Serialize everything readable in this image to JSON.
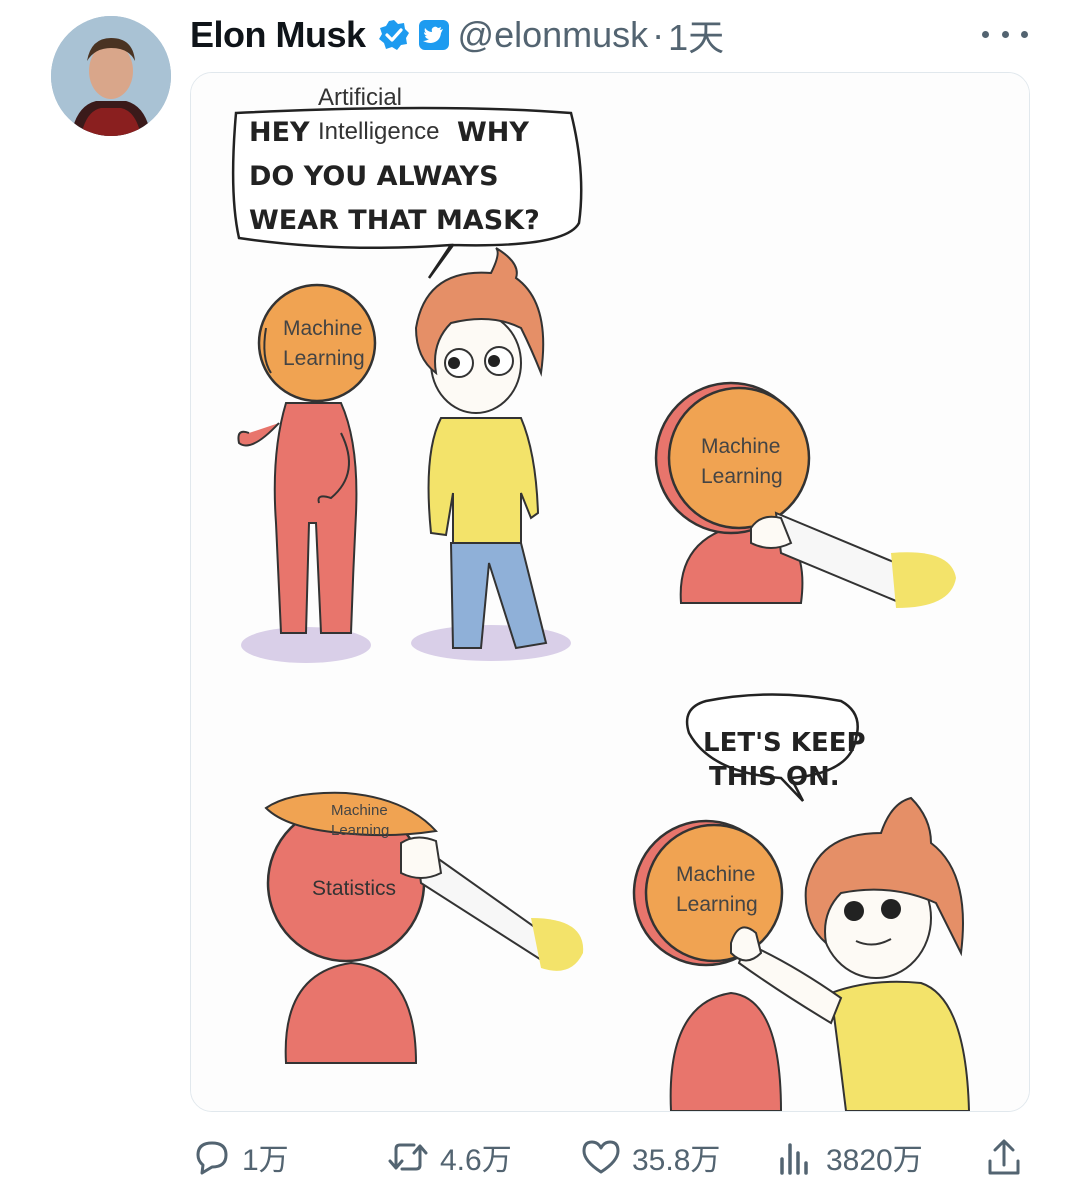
{
  "tweet": {
    "author_name": "Elon Musk",
    "handle": "@elonmusk",
    "separator": "·",
    "time": "1天"
  },
  "comic": {
    "panel1_label_top": "Artificial",
    "panel1_label_mid": "Intelligence",
    "panel1_bubble_hey": "HEY",
    "panel1_bubble_why": "WHY",
    "panel1_bubble_line2": "DO YOU ALWAYS",
    "panel1_bubble_line3": "WEAR THAT MASK?",
    "mask_line1": "Machine",
    "mask_line2": "Learning",
    "hidden_face": "Statistics",
    "panel4_bubble_line1": "LET'S KEEP",
    "panel4_bubble_line2": "THIS ON."
  },
  "actions": {
    "replies": "1万",
    "retweets": "4.6万",
    "likes": "35.8万",
    "views": "3820万"
  },
  "icons": [
    "verified-badge-icon",
    "twitter-bird-icon",
    "more-icon",
    "reply-icon",
    "retweet-icon",
    "like-icon",
    "views-icon",
    "share-icon"
  ],
  "colors": {
    "verified": "#1d9bf0",
    "muted": "#536471",
    "skin": "#e8756c",
    "mask": "#f0a352",
    "shirt": "#f3e36a",
    "pants": "#8fb0d8"
  }
}
